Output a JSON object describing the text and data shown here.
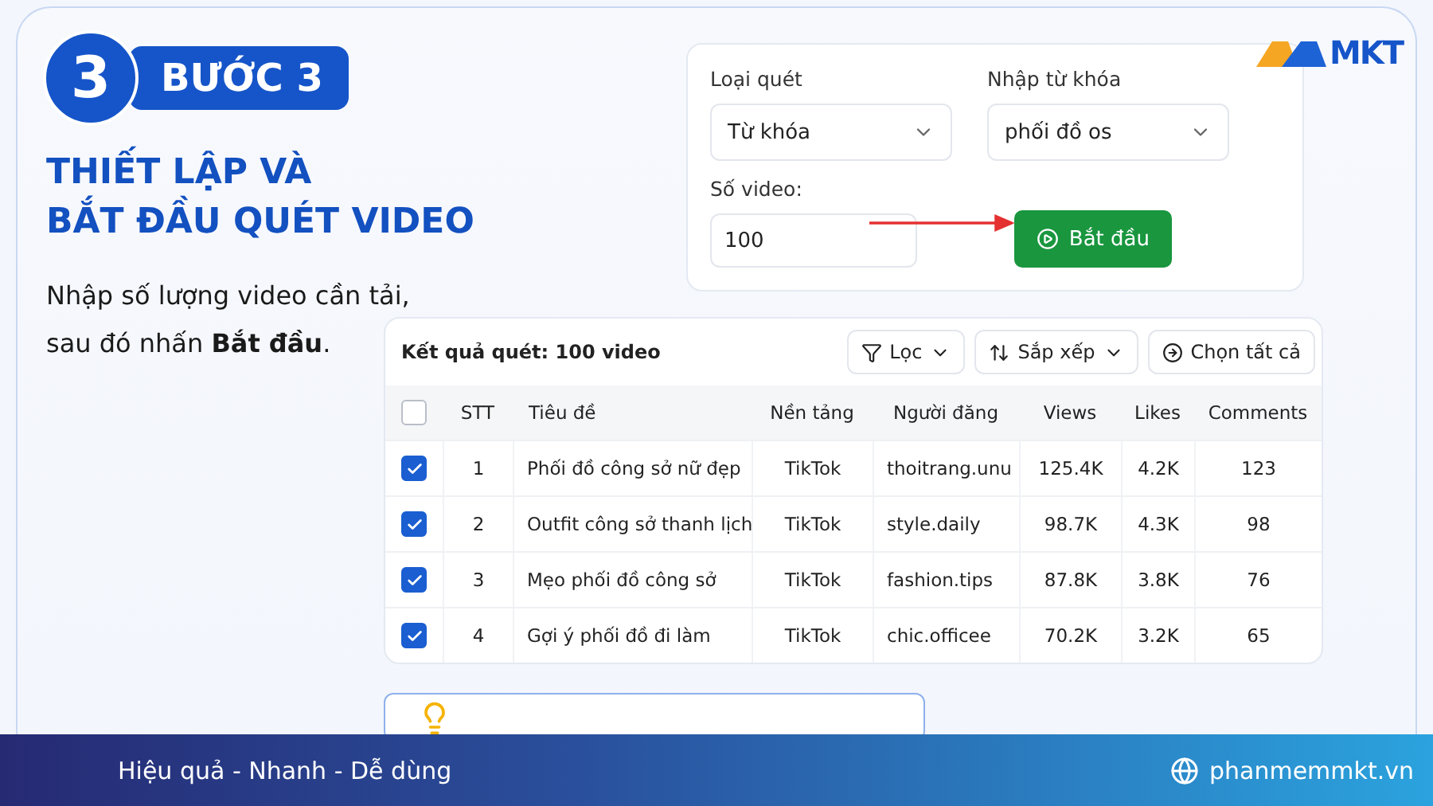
{
  "step": {
    "number": "3",
    "badge": "BƯỚC 3"
  },
  "heading": [
    "THIẾT LẬP VÀ",
    "BẮT ĐẦU QUÉT VIDEO"
  ],
  "description": [
    "Nhập số lượng video cần tải,",
    "sau đó nhấn **Bắt đầu**."
  ],
  "logo": {
    "text": "MKT"
  },
  "settings": {
    "scan_type": {
      "label": "Loại quét",
      "value": "Từ khóa"
    },
    "keyword": {
      "label": "Nhập từ khóa",
      "value": "phối đồ os"
    },
    "count": {
      "label": "Số video:",
      "value": "100"
    },
    "start_button": "Bắt đầu"
  },
  "results": {
    "title": "Kết quả quét: 100 video",
    "filter_button": "Lọc",
    "sort_button": "Sắp xếp",
    "select_all_button": "Chọn tất cả",
    "header_checked": false,
    "columns": [
      "STT",
      "Tiêu đề",
      "Nền tảng",
      "Người đăng",
      "Views",
      "Likes",
      "Comments"
    ],
    "rows": [
      {
        "checked": true,
        "cells": [
          "1",
          "Phối đồ công sở nữ đẹp",
          "TikTok",
          "thoitrang.unu",
          "125.4K",
          "4.2K",
          "123"
        ]
      },
      {
        "checked": true,
        "cells": [
          "2",
          "Outfit công sở thanh lịch",
          "TikTok",
          "style.daily",
          "98.7K",
          "4.3K",
          "98"
        ]
      },
      {
        "checked": true,
        "cells": [
          "3",
          "Mẹo phối đồ công sở",
          "TikTok",
          "fashion.tips",
          "87.8K",
          "3.8K",
          "76"
        ]
      },
      {
        "checked": true,
        "cells": [
          "4",
          "Gợi ý phối đồ đi làm",
          "TikTok",
          "chic.officee",
          "70.2K",
          "3.2K",
          "65"
        ]
      }
    ]
  },
  "footer": {
    "tagline": "Hiệu quả - Nhanh  - Dễ dùng",
    "website": "phanmemmkt.vn"
  }
}
